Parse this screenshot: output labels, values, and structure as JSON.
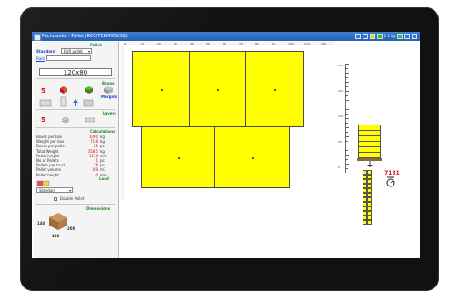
{
  "window": {
    "title": "Pachowska - Pallet (REC/TERMIOS/SQ)",
    "status_text": "1 1 kg"
  },
  "left_panel": {
    "section_pallet": "Pallet",
    "standard_label": "Standard",
    "standard_value": "EUR pallet",
    "rack_link": "Rack",
    "pallet_size": "120x80",
    "boxes_label": "Boxes",
    "boxes_count": "5",
    "layers_label": "Layers",
    "layers_count": "5",
    "calc_header": "Calculations",
    "calc_rows": [
      {
        "label": "Boxes per box",
        "value": "1000",
        "unit": "kg"
      },
      {
        "label": "Weight per box",
        "value": "71.8",
        "unit": "kg"
      },
      {
        "label": "Boxes per pallet",
        "value": "25",
        "unit": "pc"
      },
      {
        "label": "Total Weight",
        "value": "358.5",
        "unit": "kg"
      },
      {
        "label": "Pallet height",
        "value": "1110",
        "unit": "mm"
      },
      {
        "label": "No of Pallets",
        "value": "1",
        "unit": "pc"
      },
      {
        "label": "Pallets per truck",
        "value": "18",
        "unit": "pc"
      },
      {
        "label": "Pallet volume",
        "value": "0.9",
        "unit": "m3"
      },
      {
        "label": "Pallet height",
        "value": "0",
        "unit": "mm"
      }
    ],
    "load_label": "Load",
    "load_value": "Standard",
    "double_pallet_label": "Double Pallet",
    "dimensions_header": "Dimensions",
    "dim_a": "140",
    "dim_b": "200",
    "dim_c": "400"
  },
  "main": {
    "top_ruler_ticks": [
      "0",
      "10",
      "20",
      "30",
      "40",
      "50",
      "60",
      "70",
      "80",
      "90",
      "100",
      "110",
      "120"
    ],
    "weight_readout": "7181"
  },
  "right_ruler_ticks": [
    "200",
    "150",
    "100",
    "50",
    "0"
  ]
}
